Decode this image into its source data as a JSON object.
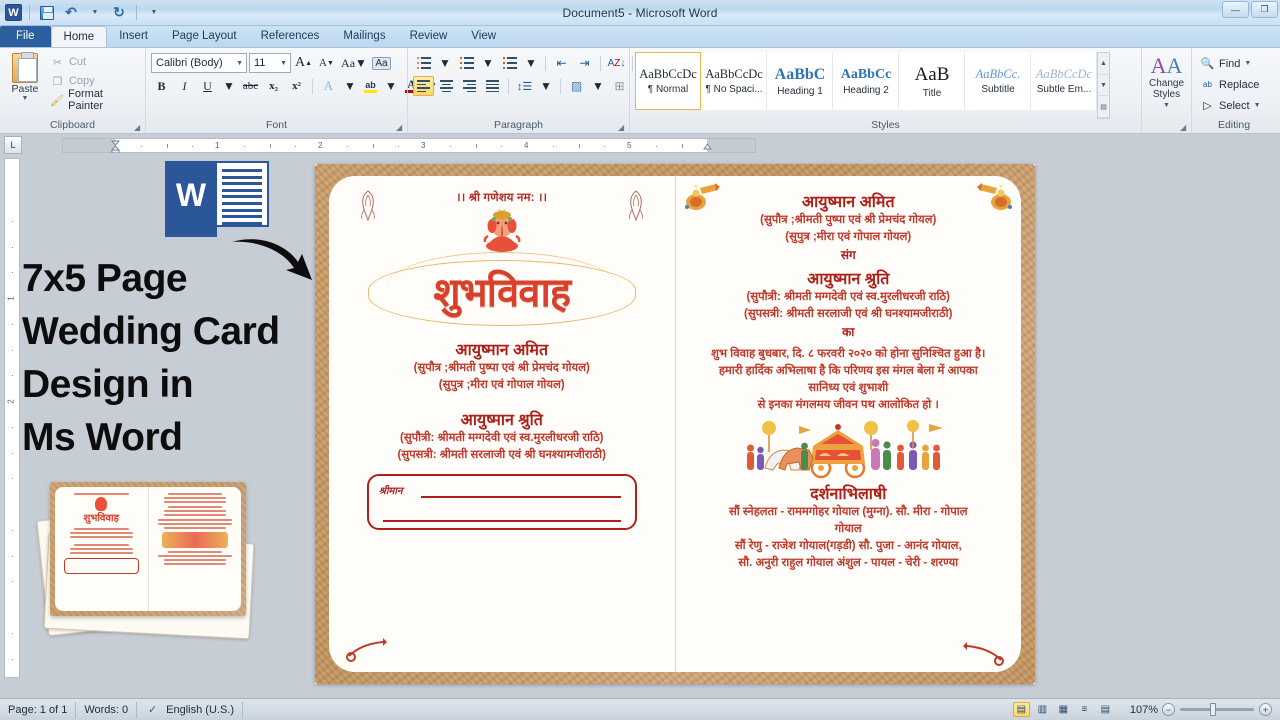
{
  "window": {
    "title": "Document5 - Microsoft Word",
    "minimize_label": "—",
    "maximize_label": "❐",
    "close_label": "✕"
  },
  "quick_access": {
    "app_icon_label": "W",
    "items": [
      {
        "name": "save",
        "label": "Save"
      },
      {
        "name": "undo",
        "label": "Undo"
      },
      {
        "name": "redo",
        "label": "Redo"
      },
      {
        "name": "customize",
        "label": "Customize Quick Access Toolbar"
      }
    ]
  },
  "ribbon": {
    "tabs": [
      {
        "label": "File",
        "active": false
      },
      {
        "label": "Home",
        "active": true
      },
      {
        "label": "Insert",
        "active": false
      },
      {
        "label": "Page Layout",
        "active": false
      },
      {
        "label": "References",
        "active": false
      },
      {
        "label": "Mailings",
        "active": false
      },
      {
        "label": "Review",
        "active": false
      },
      {
        "label": "View",
        "active": false
      }
    ],
    "clipboard": {
      "group_label": "Clipboard",
      "paste_label": "Paste",
      "cut_label": "Cut",
      "copy_label": "Copy",
      "format_painter_label": "Format Painter"
    },
    "font": {
      "group_label": "Font",
      "font_name": "Calibri (Body)",
      "font_size": "11",
      "grow_label": "A",
      "shrink_label": "A",
      "change_case_label": "Aa",
      "clear_formatting_label": "Aa",
      "bold_label": "B",
      "italic_label": "I",
      "underline_label": "U",
      "strikethrough_label": "abc",
      "subscript_label": "x₂",
      "superscript_label": "x²",
      "text_effects_label": "A",
      "highlight_label": "ab",
      "font_color_label": "A"
    },
    "paragraph": {
      "group_label": "Paragraph",
      "bullets_label": "Bullets",
      "numbering_label": "Numbering",
      "multilevel_label": "Multilevel List",
      "decrease_indent_label": "Decrease Indent",
      "increase_indent_label": "Increase Indent",
      "sort_label": "Sort",
      "show_marks_label": "¶",
      "align_left_label": "Align Left",
      "center_label": "Center",
      "align_right_label": "Align Right",
      "justify_label": "Justify",
      "line_spacing_label": "Line and Paragraph Spacing",
      "shading_label": "Shading",
      "borders_label": "Borders"
    },
    "styles": {
      "group_label": "Styles",
      "items": [
        {
          "preview": "AaBbCcDc",
          "name": "¶ Normal",
          "selected": true,
          "kind": "normal"
        },
        {
          "preview": "AaBbCcDc",
          "name": "¶ No Spaci...",
          "selected": false,
          "kind": "normal"
        },
        {
          "preview": "AaBbC",
          "name": "Heading 1",
          "selected": false,
          "kind": "h1"
        },
        {
          "preview": "AaBbCc",
          "name": "Heading 2",
          "selected": false,
          "kind": "h2"
        },
        {
          "preview": "AaB",
          "name": "Title",
          "selected": false,
          "kind": "title"
        },
        {
          "preview": "AaBbCc.",
          "name": "Subtitle",
          "selected": false,
          "kind": "subtitle"
        },
        {
          "preview": "AaBbCcDc",
          "name": "Subtle Em...",
          "selected": false,
          "kind": "subtle"
        }
      ],
      "change_styles_label": "Change\nStyles"
    },
    "editing": {
      "group_label": "Editing",
      "find_label": "Find",
      "replace_label": "Replace",
      "select_label": "Select"
    }
  },
  "ruler": {
    "h_numbers": [
      "1",
      "2",
      "3",
      "4",
      "5"
    ],
    "v_numbers": [
      "1",
      "2"
    ]
  },
  "overlay": {
    "headline_lines": [
      "7x5 Page",
      "Wedding Card",
      "Design in",
      "Ms Word"
    ],
    "word_logo_letter": "W"
  },
  "card": {
    "left_page": {
      "invocation": "।। श्री गणेशय नम: ।।",
      "title_shubh": "शुभविवाह",
      "groom_name": "आयुष्मान अमित",
      "groom_line1": "(सुपौत्र ;श्रीमती पुष्पा एवं श्री प्रेमचंद गोयल)",
      "groom_line2": "(सुपुत्र ;मीरा एवं गोपाल गोयल)",
      "bride_name": "आयुष्मान श्रुति",
      "bride_line1": "(सुपौत्री: श्रीमती मग्गदेवी एवं स्व.मुरलीधरजी राठि)",
      "bride_line2": "(सुपसत्री: श्रीमती सरलाजी एवं श्री घनश्यामजीराठी)",
      "guest_label": "श्रीमान"
    },
    "right_page": {
      "groom_name": "आयुष्मान अमित",
      "groom_line1": "(सुपौत्र ;श्रीमती पुष्पा एवं श्री प्रेमचंद गोयल)",
      "groom_line2": "(सुपुत्र ;मीरा एवं गोपाल गोयल)",
      "connector_sang": "संग",
      "bride_name": "आयुष्मान श्रुति",
      "bride_line1": "(सुपौत्री: श्रीमती मग्गदेवी एवं स्व.मुरलीधरजी राठि)",
      "bride_line2": "(सुपसत्री: श्रीमती सरलाजी एवं श्री घनश्यामजीराठी)",
      "connector_ka": "का",
      "body_line1": "शुभ विवाह बुधबार, दि. ८ फरवरी २०२० को होना सुनिश्चित हुआ है।",
      "body_line2": "हमारी हार्दिक अभिलाषा है कि परिणय इस मंगल बेला में आपका",
      "body_line3": "सानिध्य एवं शुभाशी",
      "body_line4": "से इनका मंगलमय जीवन पथ आलोकित हो ।",
      "darshan_title": "दर्शनाभिलाषी",
      "family_line1": "सौं स्नेहलता - राममगोहर गोयाल (मुग्ना). सौ. मीरा - गोपाल",
      "family_line2": "गोयाल",
      "family_line3": "सौं रेणु - राजेश गोयाल(गड़डी) सौ. पुजा - आनंद गोयाल,",
      "family_line4": "सौ. अनुरी राहुल गोयाल अंशुल - पायल - चेरी - शरण्या"
    }
  },
  "status_bar": {
    "page_label": "Page: 1 of 1",
    "words_label": "Words: 0",
    "language_label": "English (U.S.)",
    "zoom_label": "107%",
    "zoom_out_label": "−",
    "zoom_in_label": "+",
    "views": [
      {
        "name": "print-layout",
        "glyph": "▤",
        "active": true
      },
      {
        "name": "full-screen-reading",
        "glyph": "▥",
        "active": false
      },
      {
        "name": "web-layout",
        "glyph": "▦",
        "active": false
      },
      {
        "name": "outline",
        "glyph": "≡",
        "active": false
      },
      {
        "name": "draft",
        "glyph": "▤",
        "active": false
      }
    ]
  },
  "colors": {
    "word_blue": "#2b579a",
    "card_red": "#c0392b",
    "card_dark_red": "#b0201b",
    "gold": "#e0a23c"
  }
}
